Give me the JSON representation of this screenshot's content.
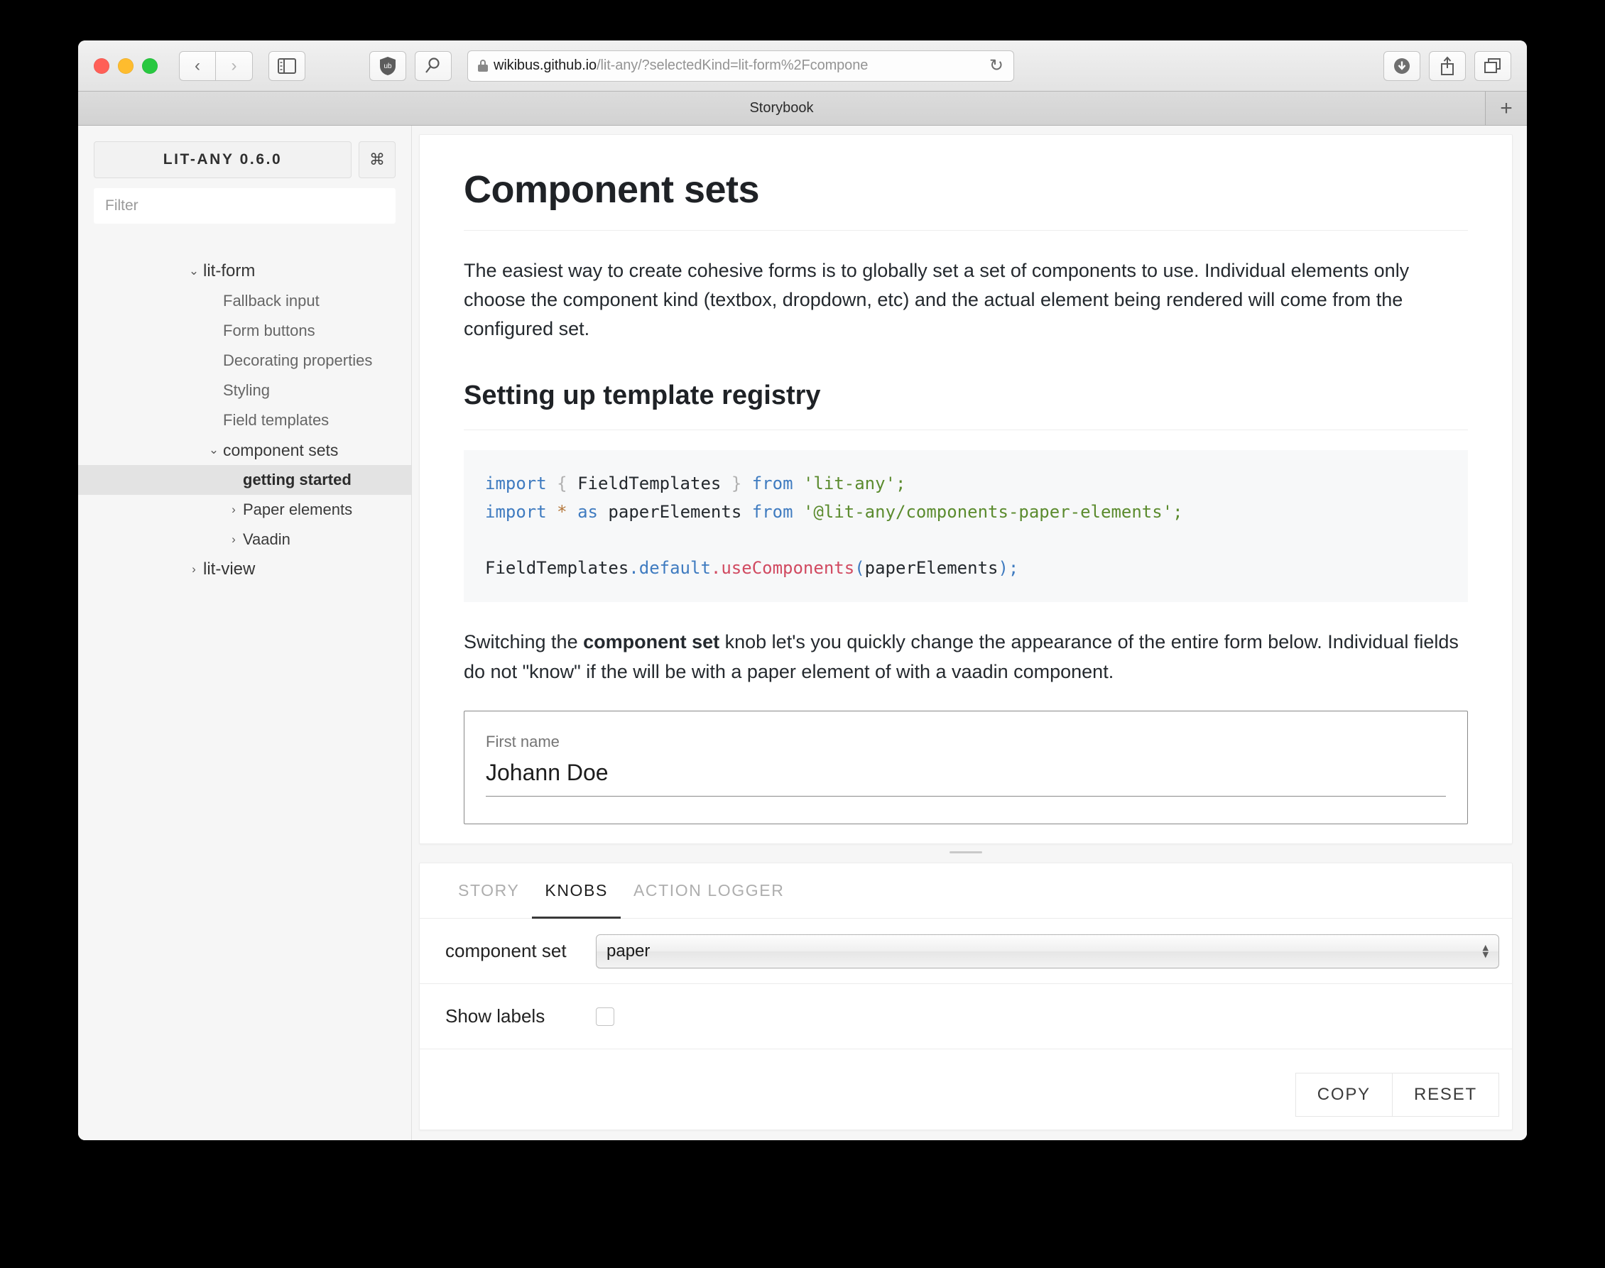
{
  "browser": {
    "url_host": "wikibus.github.io",
    "url_path": "/lit-any/?selectedKind=lit-form%2Fcompone",
    "reload_glyph": "↻",
    "back_glyph": "‹",
    "forward_glyph": "›",
    "tab_title": "Storybook",
    "new_tab_glyph": "+"
  },
  "sidebar": {
    "brand": "LIT-ANY 0.6.0",
    "shortcut_glyph": "⌘",
    "filter_placeholder": "Filter",
    "tree": [
      {
        "label": "lit-form",
        "level": 0,
        "caret": "⌄",
        "kind": "root",
        "selected": false
      },
      {
        "label": "Fallback input",
        "level": 1,
        "caret": "",
        "kind": "leaf",
        "selected": false
      },
      {
        "label": "Form buttons",
        "level": 1,
        "caret": "",
        "kind": "leaf",
        "selected": false
      },
      {
        "label": "Decorating properties",
        "level": 1,
        "caret": "",
        "kind": "leaf",
        "selected": false
      },
      {
        "label": "Styling",
        "level": 1,
        "caret": "",
        "kind": "leaf",
        "selected": false
      },
      {
        "label": "Field templates",
        "level": 1,
        "caret": "",
        "kind": "leaf",
        "selected": false
      },
      {
        "label": "component sets",
        "level": 1,
        "caret": "⌄",
        "kind": "group",
        "selected": false
      },
      {
        "label": "getting started",
        "level": 2,
        "caret": "",
        "kind": "leaf",
        "selected": true
      },
      {
        "label": "Paper elements",
        "level": 2,
        "caret": "›",
        "kind": "sub",
        "selected": false
      },
      {
        "label": "Vaadin",
        "level": 2,
        "caret": "›",
        "kind": "sub",
        "selected": false
      },
      {
        "label": "lit-view",
        "level": 0,
        "caret": "›",
        "kind": "root",
        "selected": false
      }
    ]
  },
  "doc": {
    "title": "Component sets",
    "intro": "The easiest way to create cohesive forms is to globally set a set of components to use. Individual elements only choose the component kind (textbox, dropdown, etc) and the actual element being rendered will come from the configured set.",
    "subtitle": "Setting up template registry",
    "code": {
      "line1": {
        "kw_import": "import",
        "brace_open": "{",
        "ident": "FieldTemplates",
        "brace_close": "}",
        "kw_from": "from",
        "string": "'lit-any';"
      },
      "line2": {
        "kw_import": "import",
        "star": "*",
        "kw_as": "as",
        "ident": "paperElements",
        "kw_from": "from",
        "string": "'@lit-any/components-paper-elements';"
      },
      "line3": {
        "obj": "FieldTemplates",
        "prop": ".default",
        "fn": ".useComponents",
        "paren_open": "(",
        "arg": "paperElements",
        "paren_close": ");"
      }
    },
    "body_before_bold": "Switching the ",
    "body_bold": "component set",
    "body_after_bold": " knob let's you quickly change the appearance of the entire form below. Individual fields do not \"know\" if the will be with a paper element of with a vaadin component."
  },
  "form": {
    "first_name_label": "First name",
    "first_name_value": "Johann Doe"
  },
  "panel": {
    "tabs": [
      {
        "label": "STORY",
        "active": false
      },
      {
        "label": "KNOBS",
        "active": true
      },
      {
        "label": "ACTION LOGGER",
        "active": false
      }
    ],
    "knobs": [
      {
        "label": "component set",
        "type": "select",
        "value": "paper"
      },
      {
        "label": "Show labels",
        "type": "checkbox",
        "checked": false
      }
    ],
    "select_up_glyph": "▴",
    "select_down_glyph": "▾",
    "copy_label": "COPY",
    "reset_label": "RESET"
  },
  "colors": {
    "accent_selected": "#e3e3e3",
    "code_keyword": "#3f7bc0",
    "code_string": "#5b8b2e",
    "code_function": "#d14a61",
    "tab_underline": "#393939"
  }
}
